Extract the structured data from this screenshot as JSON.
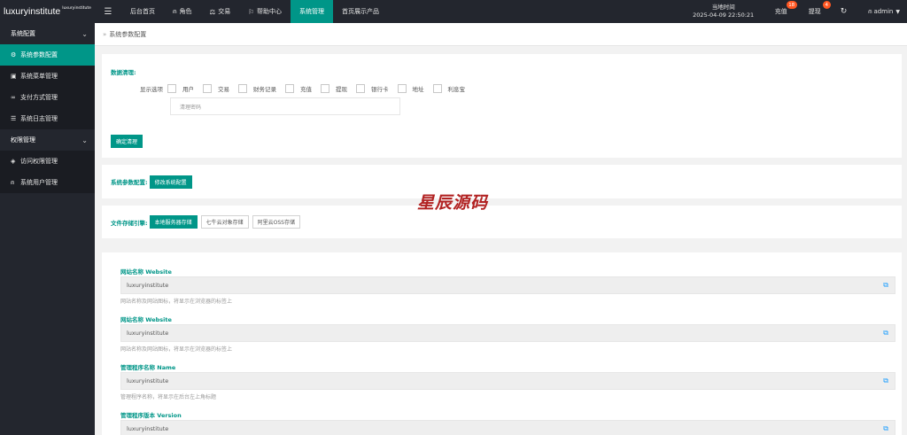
{
  "app": {
    "logo_main": "luxuryinstitute",
    "logo_sup": "luxuryinstitute"
  },
  "topnav": {
    "menu_icon": "hamburger-icon",
    "items": [
      {
        "label": "后台首页",
        "icon": ""
      },
      {
        "label": "角色",
        "icon": "user-icon"
      },
      {
        "label": "交易",
        "icon": "scale-icon"
      },
      {
        "label": "帮助中心",
        "icon": "flag-icon"
      },
      {
        "label": "系统管理",
        "icon": "",
        "active": true
      },
      {
        "label": "首页展示产品",
        "icon": ""
      }
    ]
  },
  "topright": {
    "clock_label": "当地时间",
    "clock_value": "2025-04-09 22:50:21",
    "recharge_label": "充值",
    "recharge_badge": "18",
    "withdraw_label": "提现",
    "withdraw_badge": "4",
    "refresh_icon": "refresh-icon",
    "user_label": "admin",
    "user_icon": "user-icon",
    "caret_icon": "caret-down-icon"
  },
  "sidebar": {
    "groups": [
      {
        "label": "系统配置",
        "items": [
          {
            "label": "系统参数配置",
            "icon": "gear-icon",
            "active": true
          },
          {
            "label": "系统菜单管理",
            "icon": "calendar-icon"
          },
          {
            "label": "支付方式管理",
            "icon": "link-icon"
          },
          {
            "label": "系统日志管理",
            "icon": "list-icon"
          }
        ]
      },
      {
        "label": "权限管理",
        "items": [
          {
            "label": "访问权限管理",
            "icon": "shield-icon"
          },
          {
            "label": "系统用户管理",
            "icon": "user-icon"
          }
        ]
      }
    ]
  },
  "breadcrumb": {
    "sep": "»",
    "current": "系统参数配置"
  },
  "data_clear": {
    "title": "数据清理:",
    "options_label": "显示选项",
    "options": [
      "用户",
      "交易",
      "财务记录",
      "充值",
      "提现",
      "银行卡",
      "地址",
      "利息宝"
    ],
    "password_placeholder": "清理密码",
    "confirm_label": "确定清理"
  },
  "sys_params": {
    "label": "系统参数配置:",
    "button": "修改系统配置"
  },
  "storage": {
    "label": "文件存储引擎:",
    "buttons": [
      "本地服务器存储",
      "七牛云对象存储",
      "阿里云OSS存储"
    ]
  },
  "fields": [
    {
      "title": "网站名称 Website",
      "value": "luxuryinstitute",
      "hint": "网站名称及网站图标，将显示在浏览器的标签上"
    },
    {
      "title": "网站名称 Website",
      "value": "luxuryinstitute",
      "hint": "网站名称及网站图标，将显示在浏览器的标签上"
    },
    {
      "title": "管理程序名称 Name",
      "value": "luxuryinstitute",
      "hint": "管理程序名称，将显示在后台左上角标题"
    },
    {
      "title": "管理程序版本 Version",
      "value": "luxuryinstitute",
      "hint": ""
    }
  ],
  "watermark": "星辰源码",
  "colors": {
    "accent": "#009688",
    "topbar_bg": "#23262e",
    "badge": "#ff5722",
    "copy_icon": "#1e9fff"
  }
}
